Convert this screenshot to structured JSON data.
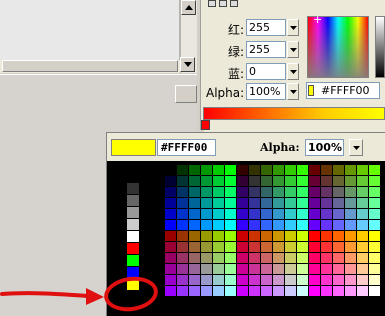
{
  "mixer": {
    "red_label": "红:",
    "red_value": "255",
    "green_label": "绿:",
    "green_value": "255",
    "blue_label": "蓝:",
    "blue_value": "0",
    "alpha_label": "Alpha:",
    "alpha_value": "100%",
    "hex_value": "#FFFF00"
  },
  "swatches_popup": {
    "hex_value": "#FFFF00",
    "alpha_label": "Alpha:",
    "alpha_value": "100%",
    "preview_color": "#ffff00"
  },
  "colors": {
    "annotation": "#e01010",
    "selected": "#ffff00"
  }
}
